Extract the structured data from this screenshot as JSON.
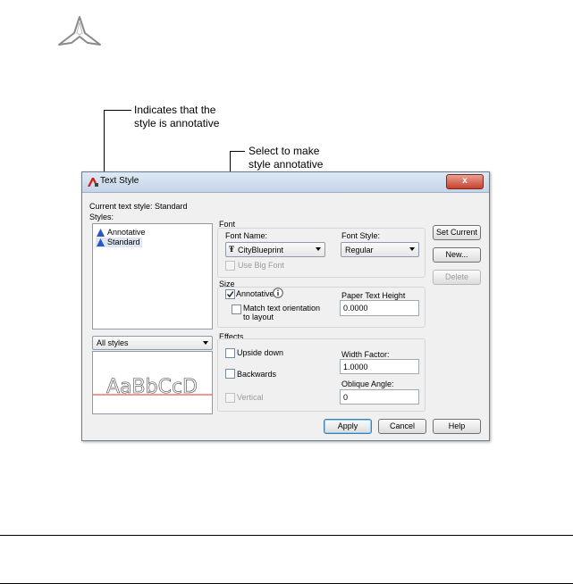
{
  "callouts": {
    "annotative_indicator": "Indicates that the style is annotative",
    "annotative_line1": "Indicates that the",
    "annotative_line2": "style is annotative",
    "select_line1": "Select to make",
    "select_line2": "style annotative"
  },
  "dialog": {
    "title": "Text Style",
    "close_glyph": "x",
    "current_style_label": "Current text style:  Standard",
    "styles_label": "Styles:",
    "styles": [
      {
        "label": "Annotative",
        "annotative": true
      },
      {
        "label": "Standard",
        "annotative": true
      }
    ],
    "filter_value": "All styles",
    "preview_text": "AaBbCcD",
    "font_group": "Font",
    "font_name_label": "Font Name:",
    "font_name_value": "CityBlueprint",
    "font_style_label": "Font Style:",
    "font_style_value": "Regular",
    "use_big_font_label": "Use Big Font",
    "size_group": "Size",
    "annotative_label": "Annotative",
    "match_orientation_line1": "Match text orientation",
    "match_orientation_line2": "to layout",
    "paper_height_label": "Paper Text Height",
    "paper_height_value": "0.0000",
    "effects_group": "Effects",
    "upside_down_label": "Upside down",
    "backwards_label": "Backwards",
    "vertical_label": "Vertical",
    "width_factor_label": "Width Factor:",
    "width_factor_value": "1.0000",
    "oblique_angle_label": "Oblique Angle:",
    "oblique_angle_value": "0",
    "buttons": {
      "set_current": "Set Current",
      "new": "New...",
      "delete": "Delete",
      "apply": "Apply",
      "cancel": "Cancel",
      "help": "Help"
    }
  },
  "colors": {
    "preview_baseline": "#e03030",
    "annotative_icon": "#2a56c6"
  }
}
